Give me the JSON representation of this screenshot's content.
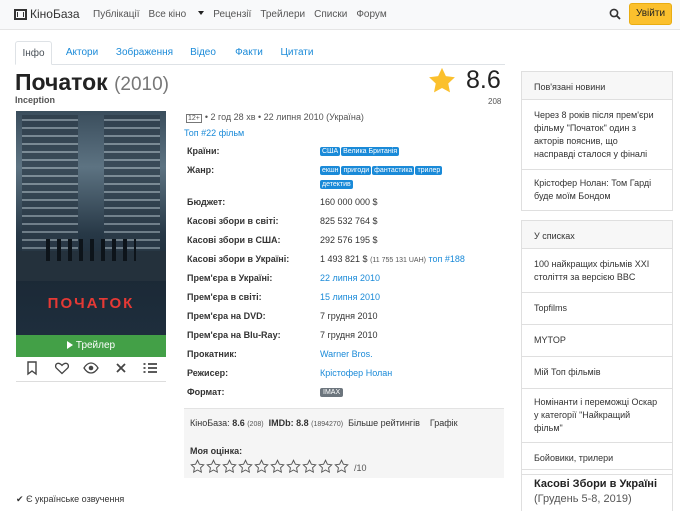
{
  "nav": {
    "brand": "КіноБаза",
    "links": [
      "Публікації",
      "Все кіно",
      "Рецензії",
      "Трейлери",
      "Списки",
      "Форум"
    ],
    "login": "Увійти"
  },
  "tabs": [
    "Інфо",
    "Актори",
    "Зображення",
    "Відео",
    "Факти",
    "Цитати"
  ],
  "movie": {
    "title": "Початок",
    "year": "(2010)",
    "original_title": "Inception",
    "rating": "8.6",
    "votes": "208",
    "age": "12+",
    "meta": "• 2 год 28 хв • 22 липня 2010 (Україна)",
    "top": "Топ #22 фільм",
    "poster_title": "ПОЧАТОК",
    "trailer": "Трейлер"
  },
  "info": {
    "countries_label": "Країни:",
    "countries": [
      "США",
      "Велика Британія"
    ],
    "genre_label": "Жанр:",
    "genres_row1": [
      "екшн",
      "пригоди",
      "фантастика",
      "трилер"
    ],
    "genres_row2": [
      "детектив"
    ],
    "budget_label": "Бюджет:",
    "budget": "160 000 000 $",
    "world_label": "Касові збори в світі:",
    "world": "825 532 764 $",
    "usa_label": "Касові збори в США:",
    "usa": "292 576 195 $",
    "ua_label": "Касові збори в Україні:",
    "ua": "1 493 821 $",
    "ua_uah": "(11 755 131 UAH)",
    "ua_top": "топ #188",
    "prem_ua_label": "Прем'єра в Україні:",
    "prem_ua": "22 липня 2010",
    "prem_world_label": "Прем'єра в світі:",
    "prem_world": "15 липня 2010",
    "dvd_label": "Прем'єра на DVD:",
    "dvd": "7 грудня 2010",
    "bluray_label": "Прем'єра на Blu-Ray:",
    "bluray": "7 грудня 2010",
    "distributor_label": "Прокатник:",
    "distributor": "Warner Bros.",
    "director_label": "Режисер:",
    "director": "Крістофер Нолан",
    "format_label": "Формат:",
    "format": "IMAX"
  },
  "ratings": {
    "kinobaza_label": "КіноБаза:",
    "kinobaza": "8.6",
    "kinobaza_votes": "(208)",
    "imdb_label": "IMDb:",
    "imdb": "8.8",
    "imdb_votes": "(1894270)",
    "more": "Більше рейтингів",
    "graph": "Графік",
    "my_rating": "Моя оцінка:",
    "out_of": "/10"
  },
  "ua_dub": "Є українське озвучення",
  "sidebar": {
    "news_title": "Пов'язані новини",
    "news": [
      "Через 8 років після прем'єри фільму \"Початок\" один з акторів пояснив, що насправді сталося у фіналі",
      "Крістофер Нолан: Том Гарді буде моїм Бондом"
    ],
    "lists_title": "У списках",
    "lists": [
      "100 найкращих фільмів XXI століття за версією BBC",
      "Topfilms",
      "MYTOP",
      "Мій Топ фільмів",
      "Номінанти і переможці Оскар у категорії \"Найкращий фільм\"",
      "Бойовики, трилери"
    ],
    "box_title": "Касові Збори в Україні",
    "box_sub": "(Грудень 5-8, 2019)"
  },
  "colors": {
    "accent": "#1a8ad8",
    "login": "#fbc02d",
    "trailer": "#43a047",
    "star": "#fbc02d"
  }
}
